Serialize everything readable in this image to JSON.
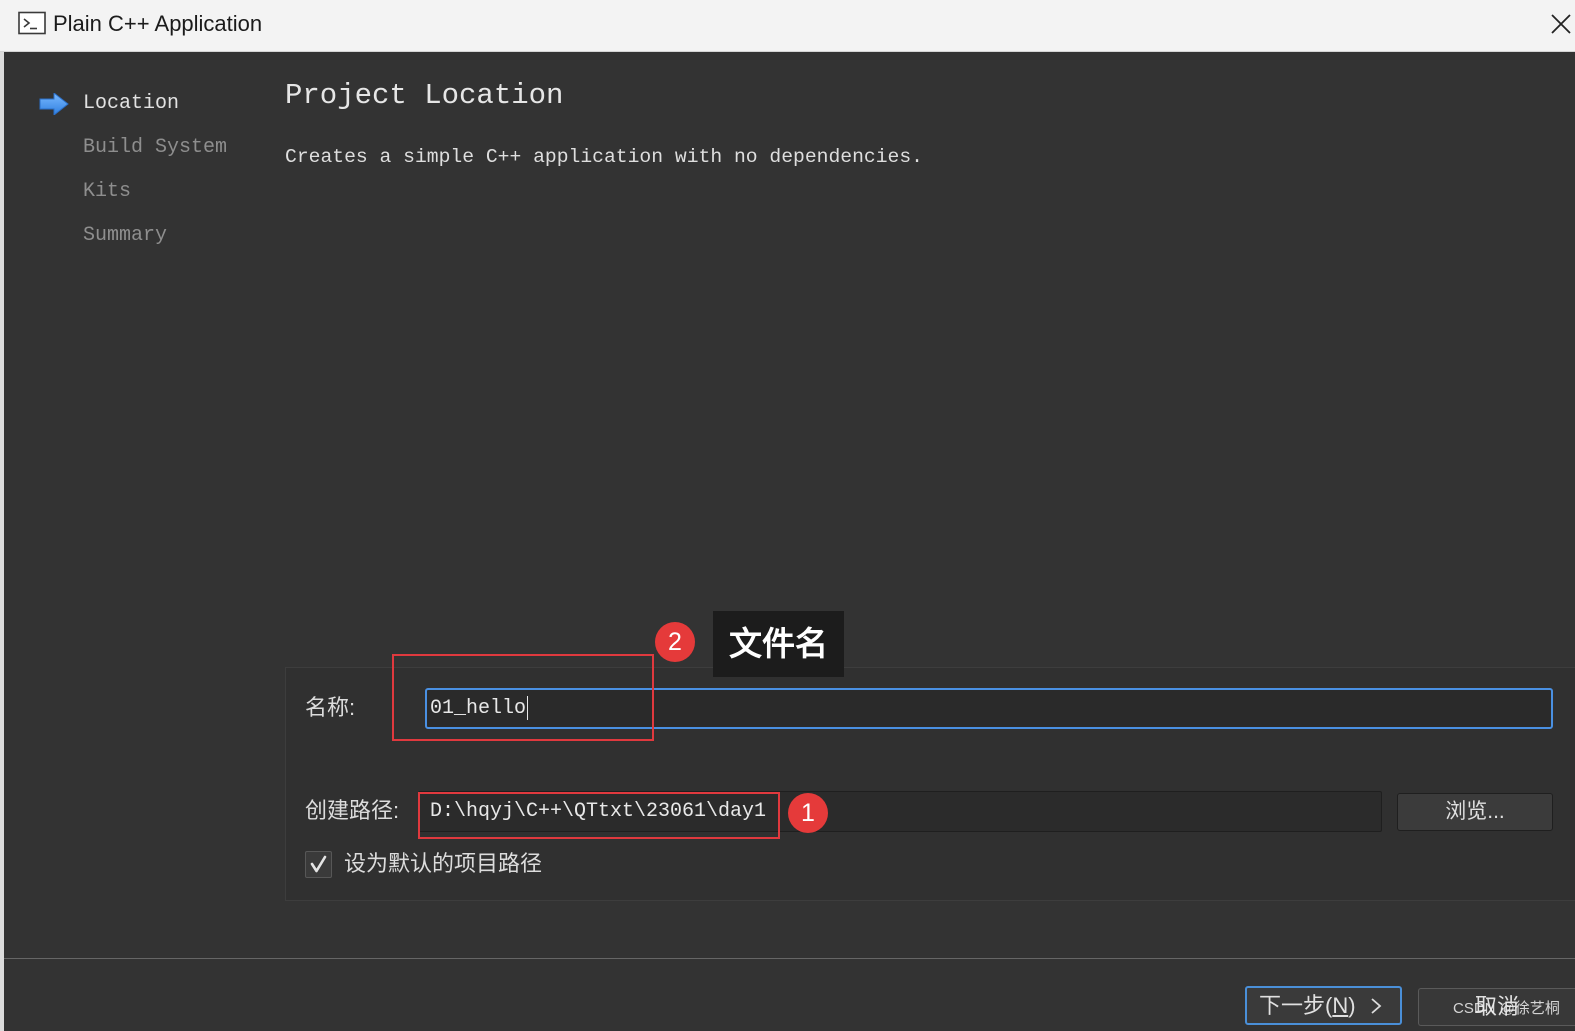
{
  "window": {
    "title": "Plain C++ Application",
    "title_icon": "terminal-icon",
    "close_icon": "close-icon"
  },
  "sidebar": {
    "active_icon": "arrow-right-icon",
    "items": [
      {
        "label": "Location",
        "active": true
      },
      {
        "label": "Build System",
        "active": false
      },
      {
        "label": "Kits",
        "active": false
      },
      {
        "label": "Summary",
        "active": false
      }
    ]
  },
  "page": {
    "title": "Project Location",
    "description": "Creates a simple C++ application with no dependencies."
  },
  "form": {
    "name_label": "名称:",
    "name_value": "01_hello",
    "path_label": "创建路径:",
    "path_value": "D:\\hqyj\\C++\\QTtxt\\23061\\day1",
    "browse_label": "浏览...",
    "default_path_label": "设为默认的项目路径",
    "default_path_checked": true
  },
  "annotations": {
    "name_badge": "2",
    "name_tooltip": "文件名",
    "path_badge": "1"
  },
  "footer": {
    "next_label_prefix": "下一步(",
    "next_label_mnemonic": "N",
    "next_label_suffix": ")",
    "next_icon": "chevron-right-icon",
    "cancel_label": "取消"
  },
  "watermark": "CSDN @徐艺桐",
  "colors": {
    "background": "#333333",
    "titlebar": "#f3f3f3",
    "focus_accent": "#4a90e2",
    "annotation_red": "#e53a3a",
    "sidebar_active_icon": "#3d8ff0"
  }
}
